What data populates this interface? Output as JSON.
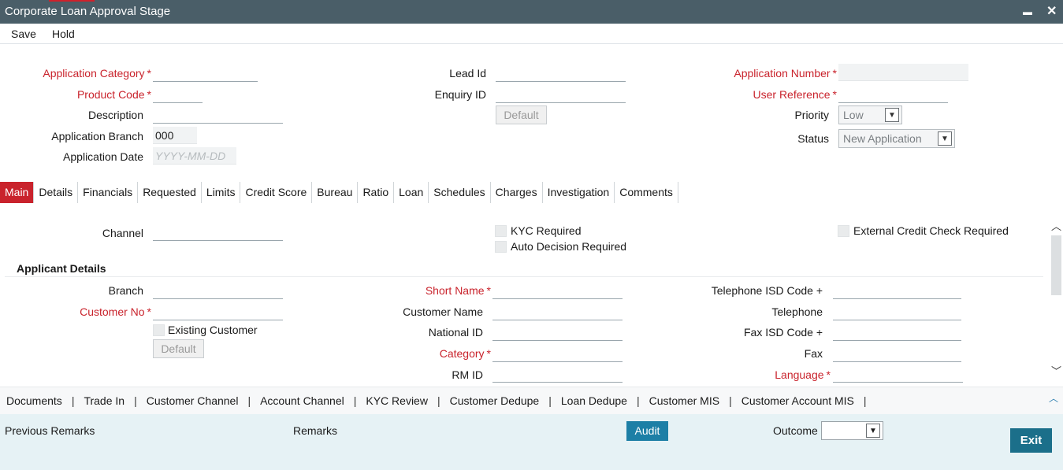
{
  "window": {
    "title": "Corporate Loan Approval Stage",
    "minimize_glyph": "▬",
    "close_glyph": "✕"
  },
  "toolbar": {
    "save": "Save",
    "hold": "Hold"
  },
  "header": {
    "app_category_label": "Application Category",
    "product_code_label": "Product Code",
    "description_label": "Description",
    "app_branch_label": "Application Branch",
    "app_branch_value": "000",
    "app_date_label": "Application Date",
    "app_date_placeholder": "YYYY-MM-DD",
    "lead_id_label": "Lead Id",
    "enquiry_id_label": "Enquiry ID",
    "default_button": "Default",
    "app_number_label": "Application Number",
    "user_ref_label": "User Reference",
    "priority_label": "Priority",
    "priority_value": "Low",
    "status_label": "Status",
    "status_value": "New Application",
    "required_mark": "*"
  },
  "tabs": [
    "Main",
    "Details",
    "Financials",
    "Requested",
    "Limits",
    "Credit Score",
    "Bureau",
    "Ratio",
    "Loan",
    "Schedules",
    "Charges",
    "Investigation",
    "Comments"
  ],
  "main": {
    "channel_label": "Channel",
    "kyc_required": "KYC Required",
    "auto_decision": "Auto Decision Required",
    "external_credit": "External Credit Check Required",
    "applicant_section": "Applicant Details",
    "branch_label": "Branch",
    "customer_no_label": "Customer No",
    "existing_customer": "Existing Customer",
    "default_button": "Default",
    "short_name_label": "Short Name",
    "customer_name_label": "Customer Name",
    "national_id_label": "National ID",
    "category_label": "Category",
    "rm_id_label": "RM ID",
    "tel_isd_label": "Telephone ISD Code +",
    "telephone_label": "Telephone",
    "fax_isd_label": "Fax ISD Code +",
    "fax_label": "Fax",
    "language_label": "Language"
  },
  "links": [
    "Documents",
    "Trade In",
    "Customer Channel",
    "Account Channel",
    "KYC Review",
    "Customer Dedupe",
    "Loan Dedupe",
    "Customer MIS",
    "Customer Account MIS"
  ],
  "link_separator": "|",
  "footer": {
    "previous_remarks": "Previous Remarks",
    "remarks": "Remarks",
    "audit": "Audit",
    "outcome_label": "Outcome",
    "exit": "Exit"
  },
  "colors": {
    "titlebar": "#4a5e68",
    "required_red": "#c9232c",
    "active_tab": "#c9232c",
    "audit_button": "#1d7fa6",
    "exit_button": "#1b6f8a",
    "footer_bg": "#e6f2f5"
  }
}
